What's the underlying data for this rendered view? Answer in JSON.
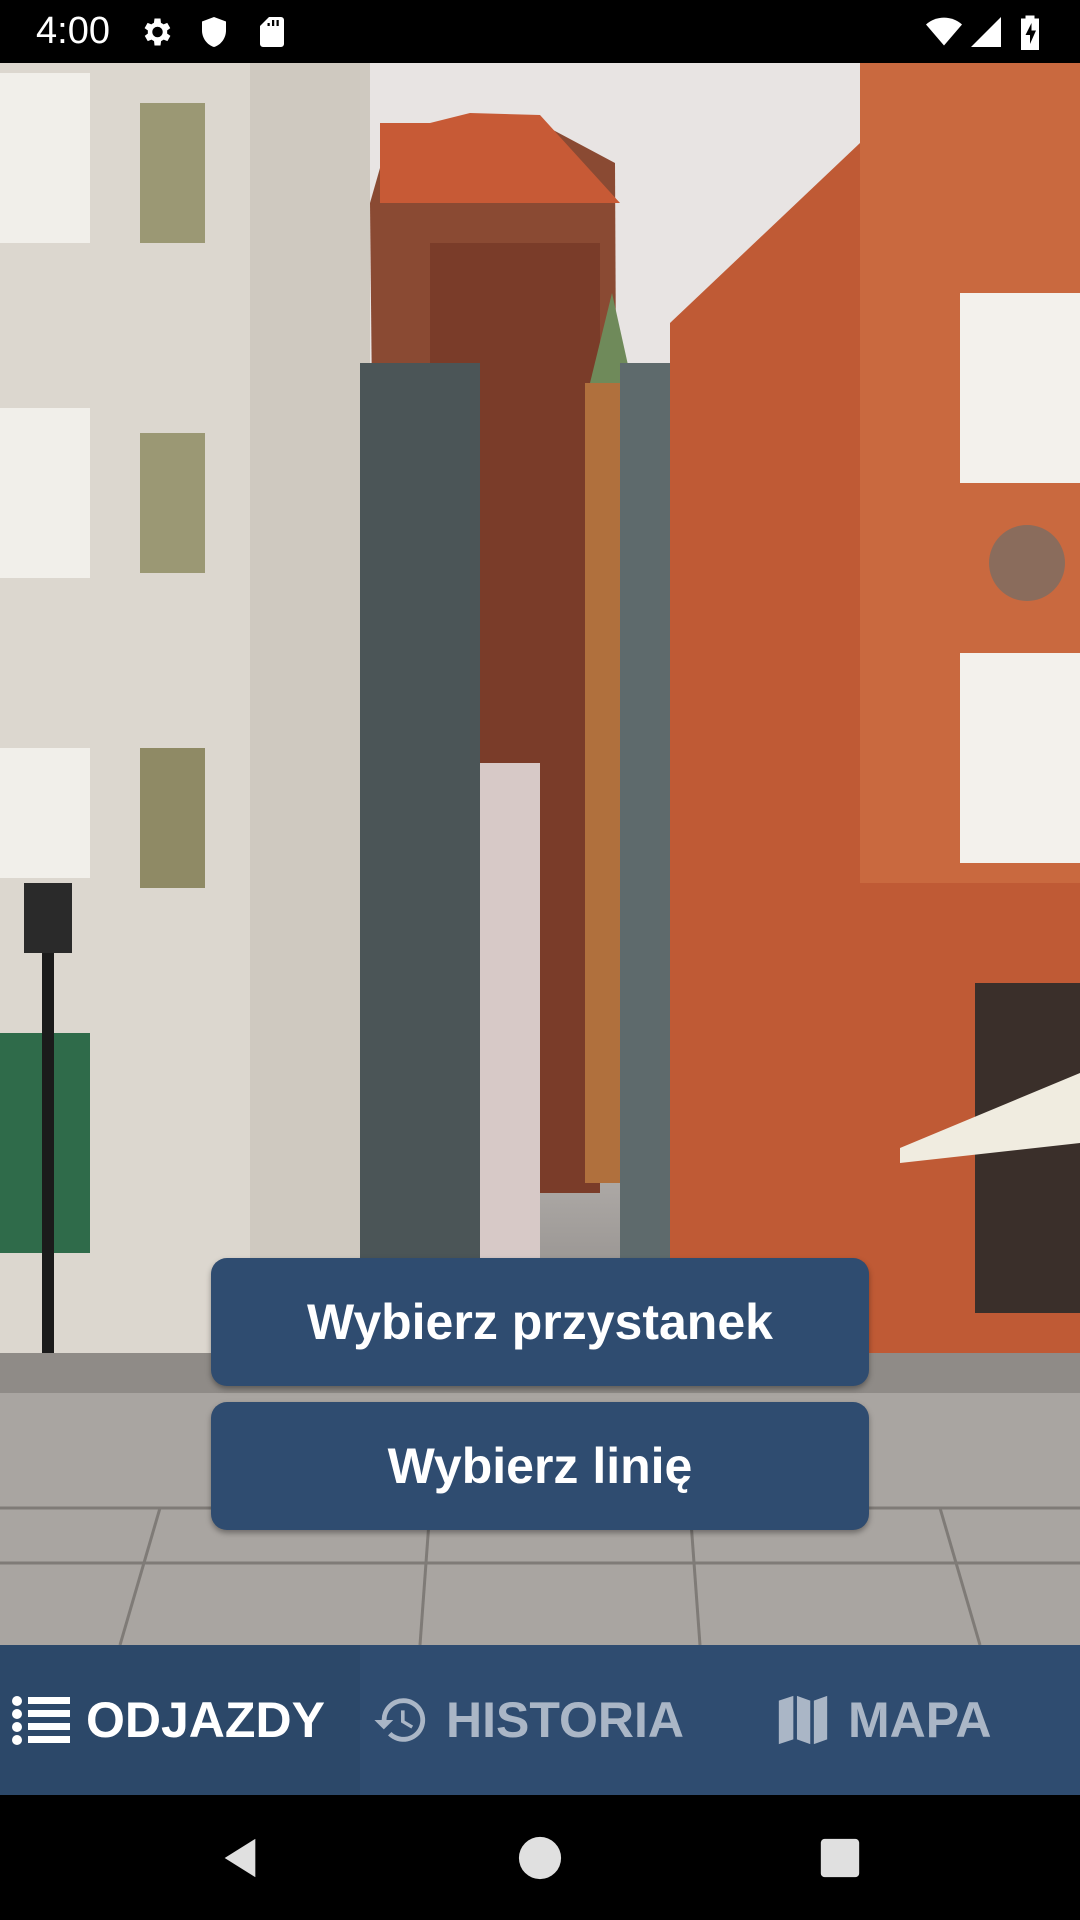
{
  "status_bar": {
    "time": "4:00",
    "left_icons": [
      "gear-icon",
      "shield-icon",
      "sd-card-icon"
    ],
    "right_icons": [
      "wifi-icon",
      "cellular-signal-icon",
      "battery-charging-icon"
    ]
  },
  "main": {
    "select_stop_label": "Wybierz przystanek",
    "select_line_label": "Wybierz linię"
  },
  "tabs": [
    {
      "label": "ODJAZDY",
      "icon": "list-icon",
      "active": true
    },
    {
      "label": "HISTORIA",
      "icon": "history-icon",
      "active": false
    },
    {
      "label": "MAPA",
      "icon": "map-icon",
      "active": false
    }
  ],
  "nav_bar": {
    "buttons": [
      "back-icon",
      "home-icon",
      "recents-icon"
    ]
  },
  "colors": {
    "primary": "#2f4c70",
    "tab_active_text": "#ffffff",
    "tab_inactive_text": "#aab6c6"
  }
}
